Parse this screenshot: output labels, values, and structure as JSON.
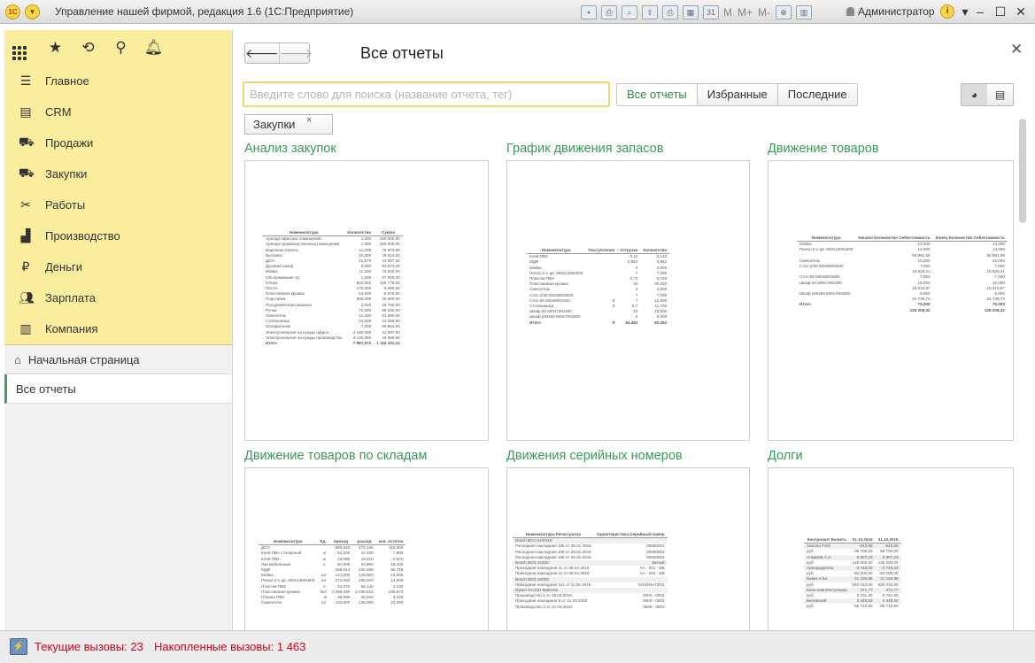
{
  "titlebar": {
    "title": "Управление нашей фирмой, редакция 1.6  (1С:Предприятие)",
    "user": "Администратор",
    "memory": [
      "M",
      "M+",
      "M-"
    ]
  },
  "sidebar": {
    "sections": [
      {
        "label": "Главное",
        "icon": "menu-lines-icon"
      },
      {
        "label": "CRM",
        "icon": "contact-card-icon"
      },
      {
        "label": "Продажи",
        "icon": "basket-icon"
      },
      {
        "label": "Закупки",
        "icon": "cart-icon"
      },
      {
        "label": "Работы",
        "icon": "tools-icon"
      },
      {
        "label": "Производство",
        "icon": "factory-icon"
      },
      {
        "label": "Деньги",
        "icon": "ruble-coin-icon"
      },
      {
        "label": "Зарплата",
        "icon": "people-icon"
      },
      {
        "label": "Компания",
        "icon": "building-icon"
      }
    ],
    "home": "Начальная страница",
    "open_window": "Все отчеты"
  },
  "main": {
    "title": "Все отчеты",
    "search_placeholder": "Введите слово для поиска (название отчета, тег)",
    "filters": {
      "all": "Все отчеты",
      "favorites": "Избранные",
      "recent": "Последние"
    },
    "tag": "Закупки",
    "reports": [
      {
        "title": "Анализ закупок"
      },
      {
        "title": "График движения запасов"
      },
      {
        "title": "Движение товаров"
      },
      {
        "title": "Движение товаров по складам"
      },
      {
        "title": "Движения серийных номеров"
      },
      {
        "title": "Долги"
      }
    ]
  },
  "previews": {
    "purchases": {
      "headers": [
        "Номенклатура",
        "Количество",
        "Сумма"
      ],
      "rows": [
        [
          "Аренда офисных помещений",
          "1,000",
          "150 000,00"
        ],
        [
          "Аренда производственных помещений",
          "1,000",
          "180 000,00"
        ],
        [
          "Варочная панель",
          "11,000",
          "76 973,00"
        ],
        [
          "Вытяжка",
          "10,000",
          "79 614,00"
        ],
        [
          "ДСП",
          "41,570",
          "13 967,52"
        ],
        [
          "Духовой шкаф",
          "8,000",
          "83 974,00"
        ],
        [
          "Мойка",
          "11,000",
          "70 620,00"
        ],
        [
          "Обслуживание 1С",
          "1,000",
          "27 000,00"
        ],
        [
          "Опора",
          "804,000",
          "115 776,00"
        ],
        [
          "Петля",
          "170,000",
          "9 350,00"
        ],
        [
          "Пластиковая кромка",
          "54,800",
          "8 576,00"
        ],
        [
          "Подставка",
          "500,000",
          "25 000,00"
        ],
        [
          "Посудомоечная машина",
          "2,000",
          "16 760,00"
        ],
        [
          "Ручка",
          "70,000",
          "66 330,00"
        ],
        [
          "Смеситель",
          "11,000",
          "61 390,00"
        ],
        [
          "Столешница",
          "14,000",
          "14 455,60"
        ],
        [
          "Холодильник",
          "7,000",
          "90 864,00"
        ],
        [
          "Электроэнергия на нужды офиса",
          "2 150,000",
          "11 997,00"
        ],
        [
          "Электроэнергия на нужды производства",
          "4 120,000",
          "16 068,00"
        ]
      ],
      "total": [
        "Итого",
        "7 987,570",
        "1 116 331,12"
      ]
    },
    "schedule": {
      "headers": [
        "Номенклатура",
        "Поступление",
        "Отгрузка",
        "Количество"
      ],
      "rows": [
        [
          "Клей ПВХ",
          "",
          "0,12",
          "0,120"
        ],
        [
          "МДФ",
          "",
          "0,852",
          "0,852"
        ],
        [
          "Мойка",
          "",
          "4",
          "4,000"
        ],
        [
          "Пенал 2-х дв. 600х1400х600",
          "",
          "7",
          "7,000"
        ],
        [
          "Пластик ПВХ",
          "",
          "0,72",
          "0,720"
        ],
        [
          "Пластиковая кромка",
          "",
          "30",
          "30,000"
        ],
        [
          "Смеситель",
          "",
          "4",
          "4,000"
        ],
        [
          "Стол 2/30 600х800х500",
          "",
          "7",
          "7,000"
        ],
        [
          "Стол 60 600х800х500",
          "5",
          "7",
          "12,000"
        ],
        [
          "Столешница",
          "3",
          "8,7",
          "11,700"
        ],
        [
          "Шкаф 60 600х700х300",
          "",
          "10",
          "10,000"
        ],
        [
          "Шкаф у60х60 600х700х600",
          "",
          "5",
          "5,000"
        ]
      ],
      "total": [
        "Итого",
        "8",
        "84,392",
        "92,392"
      ]
    },
    "goods": {
      "headers": [
        "Номенклатура",
        "Начало Количество Себестоимость",
        "Конец Количество Себестоимость"
      ],
      "rows": [
        [
          "Мойка",
          "13,000",
          "13,000"
        ],
        [
          "",
          "",
          " "
        ],
        [
          "Пенал 2-х дв. 600х1400х600",
          "14,000",
          "14,000"
        ],
        [
          "",
          "55 881,65",
          "55 881,65"
        ],
        [
          "Смеситель",
          "15,000",
          "15,000"
        ],
        [
          "",
          "",
          " "
        ],
        [
          "Стол 2/30 600х800х500",
          "7,000",
          "7,000"
        ],
        [
          "",
          "19 825,21",
          "19 825,21"
        ],
        [
          "Стол 60 600х800х500",
          "7,000",
          "7,000"
        ],
        [
          "",
          "",
          ""
        ],
        [
          "Шкаф 60 600х700х300",
          "15,000",
          "15,000"
        ],
        [
          "",
          "15 010,87",
          "15 010,87"
        ],
        [
          "Шкаф у60х60 600х700х600",
          "9,000",
          "9,000"
        ],
        [
          "",
          "22 739,72",
          "22 739,72"
        ]
      ],
      "total": [
        "Итого",
        "75,000",
        "75,000"
      ],
      "total2": [
        "",
        "128 208,32",
        "128 208,32"
      ]
    },
    "warehouses": {
      "headers": [
        "Номенклатура",
        "Ед.",
        "приход",
        "расход",
        "кон. остаток"
      ],
      "rows": [
        [
          "ДСП",
          "",
          "590,340",
          "472,340",
          "118,000"
        ],
        [
          "Клей ПВА столярный",
          "кг",
          "52,200",
          "44,400",
          "7,800"
        ],
        [
          "Клей ПВХ",
          "кг",
          "16,080",
          "15,210",
          "0,870"
        ],
        [
          "Лак мебельный",
          "л.",
          "81,900",
          "63,800",
          "18,100"
        ],
        [
          "МДФ",
          "",
          "169,014",
          "100,296",
          "68,718"
        ],
        [
          "Мойка",
          "шт",
          "141,000",
          "128,000",
          "13,000"
        ],
        [
          "Пенал 2-х дв. 600х1400х600",
          "шт",
          "272,000",
          "258,000",
          "14,000"
        ],
        [
          "Пластик ПВХ",
          "л.",
          "62,370",
          "59,140",
          "3,230"
        ],
        [
          "Пластиковая кромка",
          "бкб",
          "2 288,490",
          "2 038,516",
          "249,974"
        ],
        [
          "Пленка ПВХ",
          "м",
          "35,080",
          "25,840",
          "9,240"
        ],
        [
          "Смеситель",
          "шт",
          "143,000",
          "128,000",
          "15,000"
        ]
      ]
    },
    "serials": {
      "headers": [
        "Номенклатура Регистратор",
        "Характеристика Серийный номер"
      ],
      "rows": [
        [
          "Bosch BCH 6ATH18",
          ""
        ],
        [
          "Расходная накладная 108 от 25.01.2016",
          "00000001"
        ],
        [
          "Расходная накладная 109 от 25.01.2016",
          "00000001"
        ],
        [
          "Расходная накладная 108 от 25.01.2016",
          "00000002"
        ],
        [
          "Bosch BGS 21830",
          "Белый"
        ],
        [
          "Приходная накладная 11 от 08.04.2016",
          "АА - 001 - ББ"
        ],
        [
          "Приходная накладная 11 от 08.04.2016",
          "АА - 001 - ББ"
        ],
        [
          "Bosch BGS 32000",
          ""
        ],
        [
          "Приходная накладная 111 от 11.02.2016",
          "KG49NA73/01"
        ],
        [
          "Dyson DC43H Mattress",
          ""
        ],
        [
          "Производство 1 от 18.03.2016",
          "0000 - 0002"
        ],
        [
          "Приходная накладная 5 от 21.03.2016",
          "0000 - 0002"
        ],
        [
          "Производство 2 от 21.03.2016",
          "0000 - 0003"
        ]
      ]
    },
    "debts": {
      "headers": [
        "Контрагент Валюта",
        "01.10.2015",
        "31.10.2015"
      ],
      "rows": [
        [
          "Авилон Ford",
          "-543,68",
          "-543,68"
        ],
        [
          "руб.",
          "-36 700,00",
          "-36 700,00"
        ],
        [
          "Алкимов А.А.",
          "5 907,23",
          "5 907,23"
        ],
        [
          "руб.",
          "145 000,00",
          "145 000,00"
        ],
        [
          "Арендодатель",
          "-3 748,03",
          "-3 748,03"
        ],
        [
          "руб.",
          "-92 000,00",
          "-92 000,00"
        ],
        [
          "Бавех и Ко",
          "21 184,95",
          "21 184,95"
        ],
        [
          "руб.",
          "520 010,00",
          "520 010,00"
        ],
        [
          "База комплектующих",
          "371,77",
          "371,77"
        ],
        [
          "руб.",
          "5 701,00",
          "5 701,00"
        ],
        [
          "Белевский",
          "2 448,63",
          "2 448,63"
        ],
        [
          "руб.",
          "65 710,50",
          "65 710,50"
        ]
      ]
    }
  },
  "status": {
    "current": "Текущие вызовы: 23",
    "accumulated": "Накопленные вызовы: 1 463"
  }
}
